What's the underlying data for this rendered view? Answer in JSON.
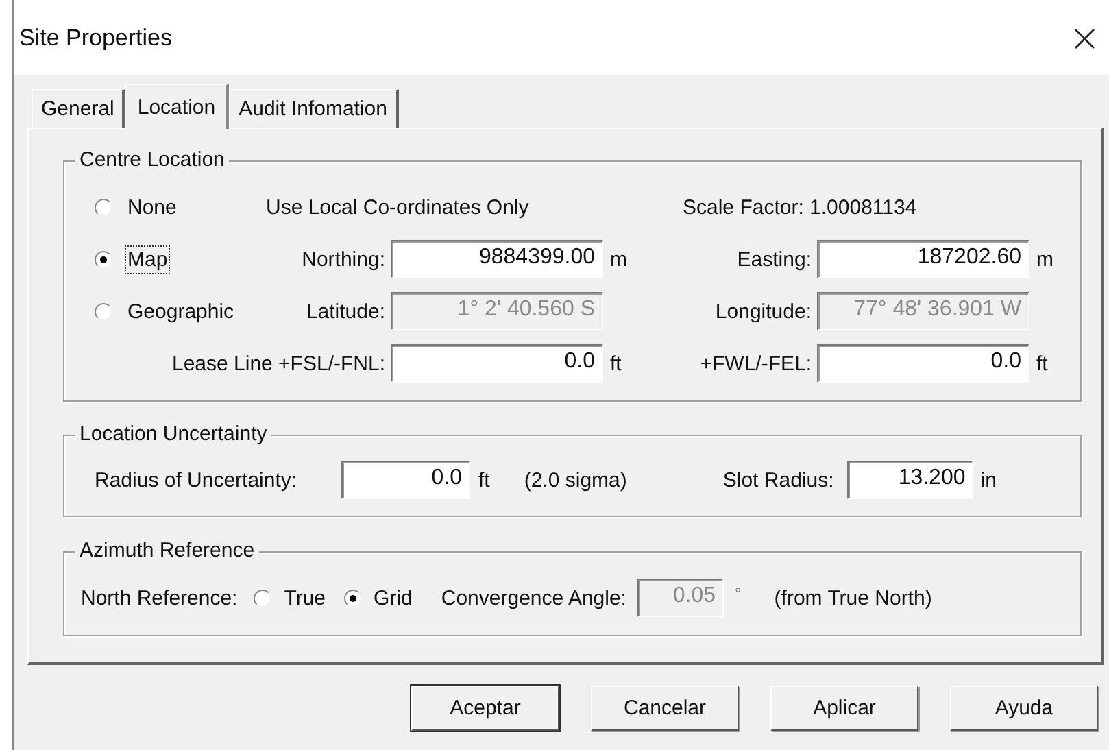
{
  "window": {
    "title": "Site Properties",
    "close": "×"
  },
  "tabs": [
    {
      "label": "General",
      "selected": false
    },
    {
      "label": "Location",
      "selected": true
    },
    {
      "label": "Audit Infomation",
      "selected": false
    }
  ],
  "centre_location": {
    "title": "Centre Location",
    "radios": [
      {
        "label": "None",
        "selected": false,
        "focused": false
      },
      {
        "label": "Map",
        "selected": true,
        "focused": true
      },
      {
        "label": "Geographic",
        "selected": false,
        "focused": false
      }
    ],
    "note": "Use Local Co-ordinates Only",
    "scale_factor": "Scale Factor: 1.00081134",
    "field_rows": [
      {
        "left": {
          "label": "Northing:",
          "value": "9884399.00",
          "unit": "m",
          "disabled": false
        },
        "right": {
          "label": "Easting:",
          "value": "187202.60",
          "unit": "m",
          "disabled": false
        }
      },
      {
        "left": {
          "label": "Latitude:",
          "value": "1° 2' 40.560 S",
          "disabled": true
        },
        "right": {
          "label": "Longitude:",
          "value": "77° 48' 36.901 W",
          "disabled": true
        }
      },
      {
        "left": {
          "label": "Lease Line  +FSL/-FNL:",
          "value": "0.0",
          "unit": "ft",
          "disabled": false
        },
        "right": {
          "label": "+FWL/-FEL:",
          "value": "0.0",
          "unit": "ft",
          "disabled": false
        }
      }
    ]
  },
  "location_uncertainty": {
    "title": "Location Uncertainty",
    "radius": {
      "label": "Radius of Uncertainty:",
      "value": "0.0",
      "unit": "ft"
    },
    "sigma": "(2.0 sigma)",
    "slot": {
      "label": "Slot Radius:",
      "value": "13.200",
      "unit": "in"
    }
  },
  "azimuth_reference": {
    "title": "Azimuth Reference",
    "north_label": "North Reference:",
    "options": [
      {
        "label": "True",
        "selected": false
      },
      {
        "label": "Grid",
        "selected": true
      }
    ],
    "convergence": {
      "label": "Convergence Angle:",
      "value": "0.05",
      "unit": "°",
      "disabled": true
    },
    "note": "(from True North)"
  },
  "buttons": [
    {
      "label": "Aceptar",
      "default": true
    },
    {
      "label": "Cancelar",
      "default": false
    },
    {
      "label": "Aplicar",
      "default": false
    },
    {
      "label": "Ayuda",
      "default": false
    }
  ]
}
